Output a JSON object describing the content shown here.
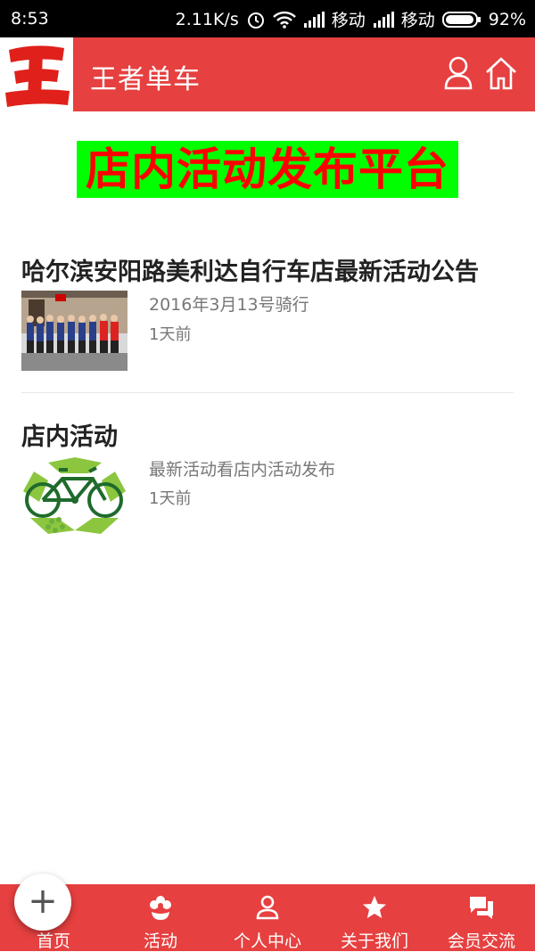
{
  "status_bar": {
    "time": "8:53",
    "speed": "2.11K/s",
    "carrier1": "移动",
    "carrier2": "移动",
    "battery": "92%"
  },
  "header": {
    "logo_text": "王",
    "title": "王者单车",
    "accent_color": "#e64040"
  },
  "banner": {
    "text": "店内活动发布平台",
    "bg_color": "#00ff00",
    "text_color": "#ff0000"
  },
  "posts": [
    {
      "title": "哈尔滨安阳路美利达自行车店最新活动公告",
      "summary": "2016年3月13号骑行",
      "time": "1天前",
      "thumbnail": "group-photo"
    },
    {
      "title": "店内活动",
      "summary": "最新活动看店内活动发布",
      "time": "1天前",
      "thumbnail": "bicycle-recycle-logo"
    }
  ],
  "bottom_nav": [
    {
      "label": "首页",
      "icon": "home-icon"
    },
    {
      "label": "活动",
      "icon": "flower-icon"
    },
    {
      "label": "个人中心",
      "icon": "person-icon"
    },
    {
      "label": "关于我们",
      "icon": "star-icon"
    },
    {
      "label": "会员交流",
      "icon": "chat-icon"
    }
  ],
  "fab": {
    "label": "+"
  }
}
